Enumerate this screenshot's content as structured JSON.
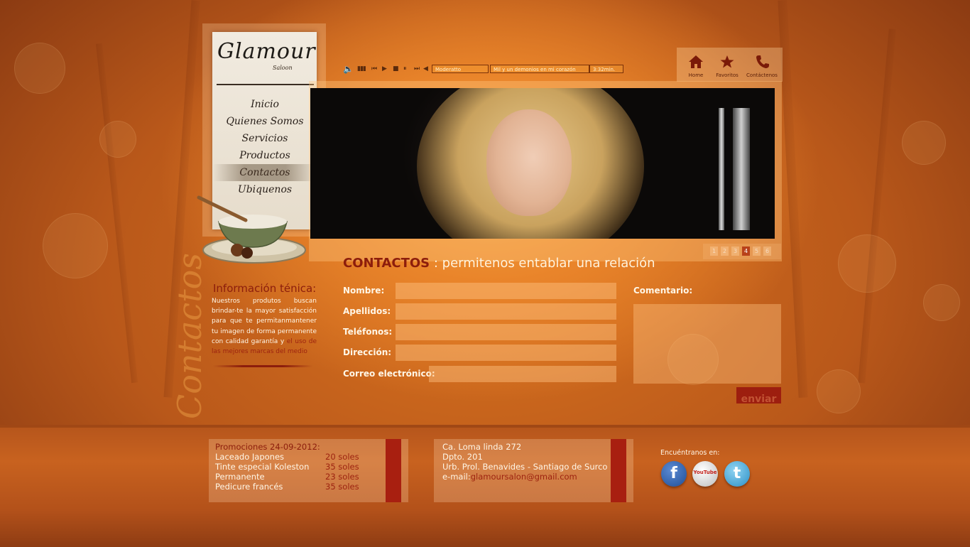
{
  "brand": {
    "logo_text": "Glamour",
    "logo_sub": "Saloon"
  },
  "nav": {
    "items": [
      {
        "label": "Inicio"
      },
      {
        "label": "Quienes Somos"
      },
      {
        "label": "Servicios"
      },
      {
        "label": "Productos"
      },
      {
        "label": "Contactos",
        "active": true
      },
      {
        "label": "Ubiquenos"
      }
    ]
  },
  "player": {
    "volume_icon": "speaker-icon",
    "controls": [
      "prev-icon",
      "play-icon",
      "stop-icon",
      "pause-icon",
      "next-icon",
      "back-icon"
    ],
    "genre": "Moderatto",
    "track": "Mil y un demonios en mi corazón",
    "duration": "3:32min."
  },
  "quick_nav": [
    {
      "label": "Home",
      "icon": "home-icon"
    },
    {
      "label": "Favoritos",
      "icon": "star-icon"
    },
    {
      "label": "Contáctenos",
      "icon": "phone-icon"
    }
  ],
  "slider": {
    "pages": [
      "1",
      "2",
      "3",
      "4",
      "5",
      "6"
    ],
    "active": 4
  },
  "contact": {
    "title_strong": "CONTACTOS",
    "title_rest": " : permitenos entablar una relación"
  },
  "info": {
    "title": "Información ténica:",
    "body_plain": "Nuestros produtos buscan brindar-te la mayor satisfacción para que te permitanmantener tu imagen de forma permanente con calidad garantía y ",
    "body_highlight": "el uso de las mejores marcas del medio",
    "side_word": "Contactos"
  },
  "form": {
    "nombre_label": "Nombre:",
    "apellidos_label": "Apellidos:",
    "telefonos_label": "Teléfonos:",
    "direccion_label": "Dirección:",
    "correo_label": "Correo electrónico:",
    "comentario_label": "Comentario:",
    "submit_label": "enviar"
  },
  "promos": {
    "title": "Promociones 24-09-2012:",
    "items": [
      {
        "name": "Laceado Japones",
        "price": "20 soles"
      },
      {
        "name": "Tinte especial Koleston",
        "price": "35 soles"
      },
      {
        "name": "Permanente",
        "price": "23 soles"
      },
      {
        "name": "Pedicure francés",
        "price": "35 soles"
      }
    ]
  },
  "address": {
    "line1": "Ca. Loma linda 272",
    "line2": "Dpto. 201",
    "line3": "Urb. Prol. Benavides - Santiago de Surco",
    "email_label": "e-mail:",
    "email": "glamoursalon@gmail.com"
  },
  "social": {
    "title": "Encuéntranos en:",
    "networks": [
      {
        "name": "facebook",
        "icon": "facebook-icon",
        "text": "f",
        "color": "#2f5fa8"
      },
      {
        "name": "youtube",
        "icon": "youtube-icon",
        "text": "YouTube",
        "color": "#d9d9d9"
      },
      {
        "name": "twitter",
        "icon": "twitter-icon",
        "text": "t",
        "color": "#3ba3d9"
      }
    ]
  },
  "colors": {
    "accent": "#8c1d0c",
    "button": "#9d1e0f",
    "background": "#e9842a"
  }
}
